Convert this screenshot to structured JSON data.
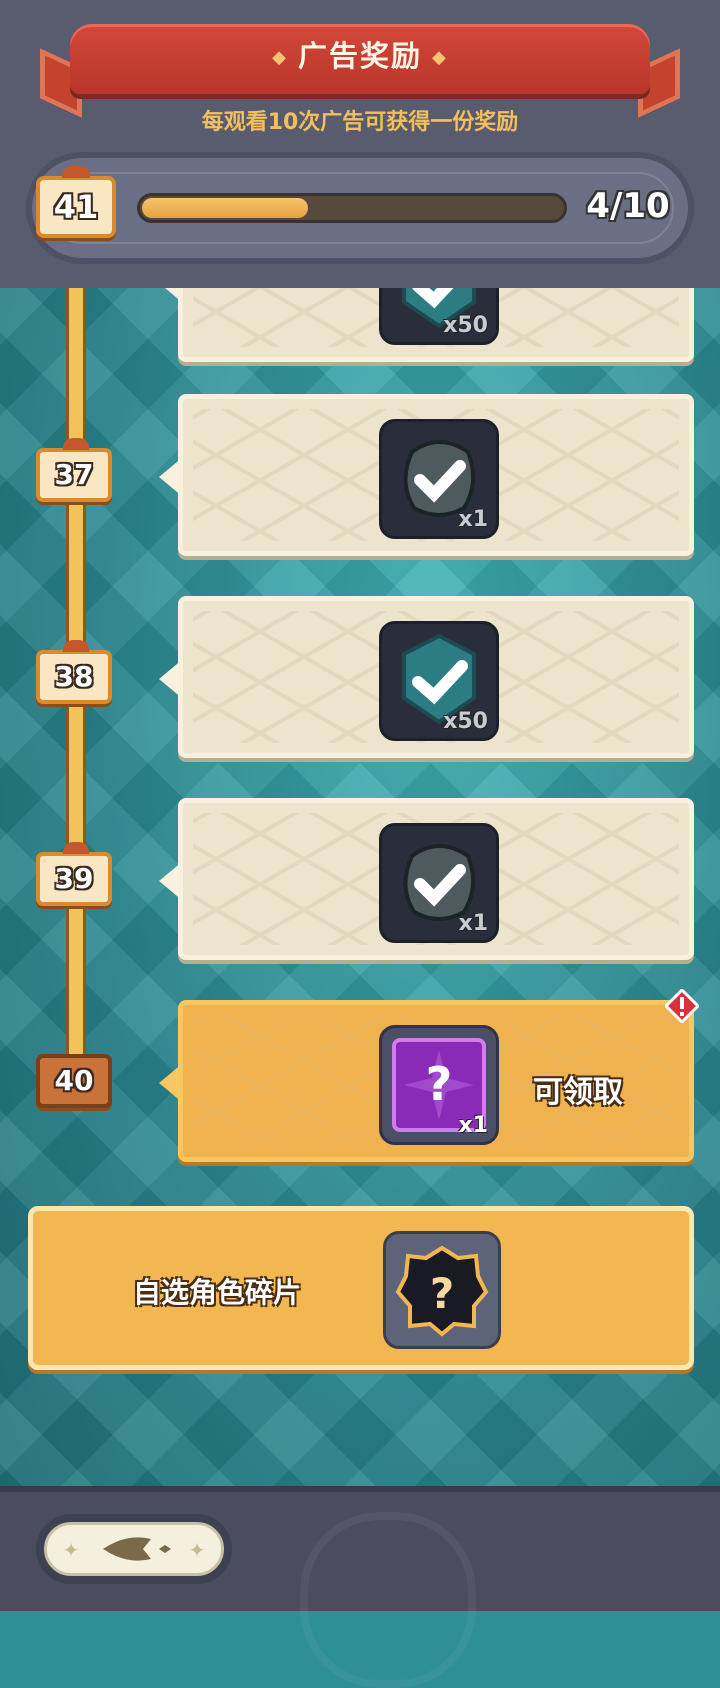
{
  "header": {
    "title": "广告奖励",
    "subtitle": "每观看10次广告可获得一份奖励",
    "level": "41",
    "progress": {
      "current": 4,
      "total": 10,
      "fraction": 0.4,
      "text": "4/10"
    }
  },
  "rewards": [
    {
      "level": "37",
      "item_icon": "armor-fragment-icon",
      "quantity": "x1"
    },
    {
      "level": "38",
      "item_icon": "gem-check-icon",
      "quantity": "x50"
    },
    {
      "level": "39",
      "item_icon": "armor-fragment-icon",
      "quantity": "x1"
    },
    {
      "level": "40",
      "item_icon": "mystery-box-icon",
      "quantity": "x1",
      "status": "可领取"
    }
  ],
  "partial_top_reward": {
    "quantity": "x50"
  },
  "selection_card": {
    "label": "自选角色碎片",
    "item_icon": "character-shard-question-icon"
  },
  "footer": {
    "back_icon": "back-arrow-icon"
  },
  "colors": {
    "header_bg": "#595c6e",
    "ribbon": "#c53e31",
    "accent": "#f2b751",
    "teal": "#2e8f95"
  }
}
